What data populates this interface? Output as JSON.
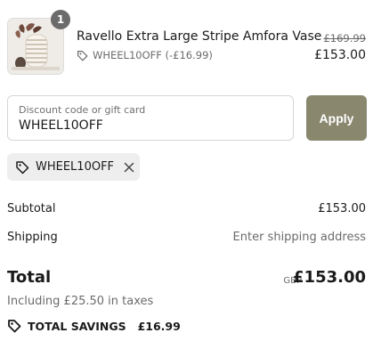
{
  "line_item": {
    "quantity": "1",
    "name": "Ravello Extra Large Stripe Amfora Vase",
    "discount_label": "WHEEL10OFF (-£16.99)",
    "original_price": "£169.99",
    "price": "£153.00",
    "icons": {
      "tag": "tag-icon"
    }
  },
  "discount_field": {
    "label": "Discount code or gift card",
    "value": "WHEEL10OFF",
    "apply_label": "Apply"
  },
  "applied_code": {
    "code": "WHEEL10OFF",
    "icons": {
      "tag": "tag-icon",
      "remove": "close-icon"
    }
  },
  "summary": {
    "subtotal_label": "Subtotal",
    "subtotal_value": "£153.00",
    "shipping_label": "Shipping",
    "shipping_value": "Enter shipping address"
  },
  "total": {
    "label": "Total",
    "currency": "GBP",
    "amount": "£153.00",
    "tax_note": "Including £25.50 in taxes",
    "savings_label": "TOTAL SAVINGS",
    "savings_amount": "£16.99"
  },
  "colors": {
    "apply_button": "#8a876f",
    "badge": "#6b6b6b",
    "chip_background": "#eeeeee",
    "muted_text": "#6b6b6b"
  }
}
